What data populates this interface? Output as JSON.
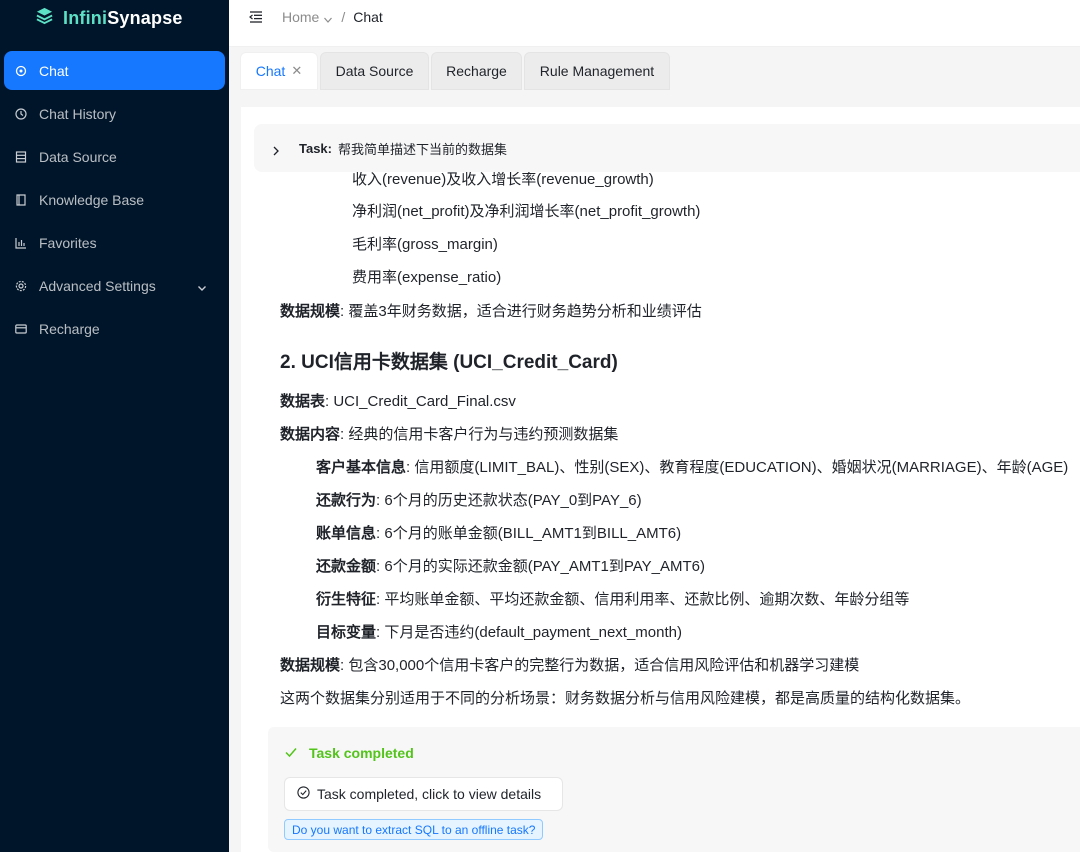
{
  "app": {
    "logo_prefix": "Infini",
    "logo_suffix": "Synapse",
    "logo_icon": "layers-icon"
  },
  "sidebar": {
    "items": [
      {
        "label": "Chat",
        "icon": "chat-icon",
        "active": true
      },
      {
        "label": "Chat History",
        "icon": "history-icon"
      },
      {
        "label": "Data Source",
        "icon": "database-icon"
      },
      {
        "label": "Knowledge Base",
        "icon": "book-icon"
      },
      {
        "label": "Favorites",
        "icon": "bar-chart-icon"
      },
      {
        "label": "Advanced Settings",
        "icon": "gear-icon",
        "expandable": true
      },
      {
        "label": "Recharge",
        "icon": "card-icon"
      }
    ]
  },
  "header": {
    "breadcrumb_home": "Home",
    "breadcrumb_sep": "/",
    "breadcrumb_current": "Chat"
  },
  "tabs": [
    {
      "label": "Chat",
      "active": true,
      "closable": true
    },
    {
      "label": "Data Source"
    },
    {
      "label": "Recharge"
    },
    {
      "label": "Rule Management"
    }
  ],
  "task": {
    "label": "Task",
    "colon": ":",
    "text": "帮我简单描述下当前的数据集"
  },
  "content": {
    "partial_line": "收入(revenue)及收入增长率(revenue_growth)",
    "l1": "净利润(net_profit)及净利润增长率(net_profit_growth)",
    "l2": "毛利率(gross_margin)",
    "l3": "费用率(expense_ratio)",
    "scale1_label": "数据规模",
    "scale1_text": ": 覆盖3年财务数据，适合进行财务趋势分析和业绩评估",
    "h2": "2. UCI信用卡数据集 (UCI_Credit_Card)",
    "table_label": "数据表",
    "table_text": ": UCI_Credit_Card_Final.csv",
    "content_label": "数据内容",
    "content_text": ": 经典的信用卡客户行为与违约预测数据集",
    "items": [
      {
        "label": "客户基本信息",
        "text": ": 信用额度(LIMIT_BAL)、性别(SEX)、教育程度(EDUCATION)、婚姻状况(MARRIAGE)、年龄(AGE)"
      },
      {
        "label": "还款行为",
        "text": ": 6个月的历史还款状态(PAY_0到PAY_6)"
      },
      {
        "label": "账单信息",
        "text": ": 6个月的账单金额(BILL_AMT1到BILL_AMT6)"
      },
      {
        "label": "还款金额",
        "text": ": 6个月的实际还款金额(PAY_AMT1到PAY_AMT6)"
      },
      {
        "label": "衍生特征",
        "text": ": 平均账单金额、平均还款金额、信用利用率、还款比例、逾期次数、年龄分组等"
      },
      {
        "label": "目标变量",
        "text": ": 下月是否违约(default_payment_next_month)"
      }
    ],
    "scale2_label": "数据规模",
    "scale2_text": ": 包含30,000个信用卡客户的完整行为数据，适合信用风险评估和机器学习建模",
    "summary": "这两个数据集分别适用于不同的分析场景：财务数据分析与信用风险建模，都是高质量的结构化数据集。"
  },
  "status": {
    "completed": "Task completed",
    "details_button": "Task completed, click to view details",
    "sql_prompt": "Do you want to extract SQL to an offline task?"
  },
  "colors": {
    "sidebar_bg": "#001529",
    "accent": "#1677ff",
    "success": "#52c41a",
    "logo_highlight": "#5ce1c6"
  }
}
